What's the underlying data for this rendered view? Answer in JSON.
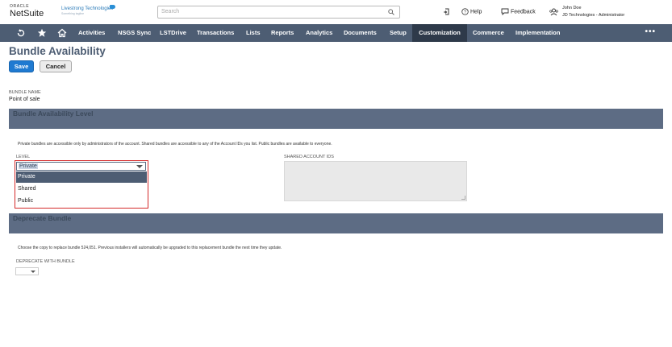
{
  "header": {
    "oracle_label": "ORACLE",
    "product_label": "NetSuite",
    "company_name": "Livestrong Technologies",
    "company_tagline": "Something tagline",
    "search_placeholder": "Search",
    "help_label": "Help",
    "feedback_label": "Feedback",
    "user_name": "John Doe",
    "user_role": "JD Technologies - Administrator"
  },
  "nav": {
    "items": [
      "Activities",
      "NSGS Sync",
      "LSTDrive",
      "Transactions",
      "Lists",
      "Reports",
      "Analytics",
      "Documents",
      "Setup",
      "Customization",
      "Commerce",
      "Implementation"
    ],
    "active": "Customization",
    "more_label": "•••"
  },
  "page": {
    "title": "Bundle Availability",
    "save_label": "Save",
    "cancel_label": "Cancel",
    "bundle_name_label": "BUNDLE NAME",
    "bundle_name_value": "Point of sale"
  },
  "availability": {
    "section_title": "Bundle Availability Level",
    "help_text": "Private bundles are accessible only by administrators of the account. Shared bundles are accessible to any of the Account IDs you list. Public bundles are available to everyone.",
    "level_label": "LEVEL",
    "level_value": "Private",
    "level_options": [
      "Private",
      "Shared",
      "Public"
    ],
    "shared_ids_label": "SHARED ACCOUNT IDS"
  },
  "deprecate": {
    "section_title": "Deprecate Bundle",
    "help_text": "Choose the copy to replace bundle 524,051. Previous installers will automatically be upgraded to this replacement bundle the next time they update.",
    "with_bundle_label": "DEPRECATE WITH BUNDLE"
  },
  "colors": {
    "nav_bg": "#4d5d73",
    "nav_active": "#2e3a4a",
    "save_button": "#1f7ad1",
    "highlight_border": "#d42a2a"
  }
}
